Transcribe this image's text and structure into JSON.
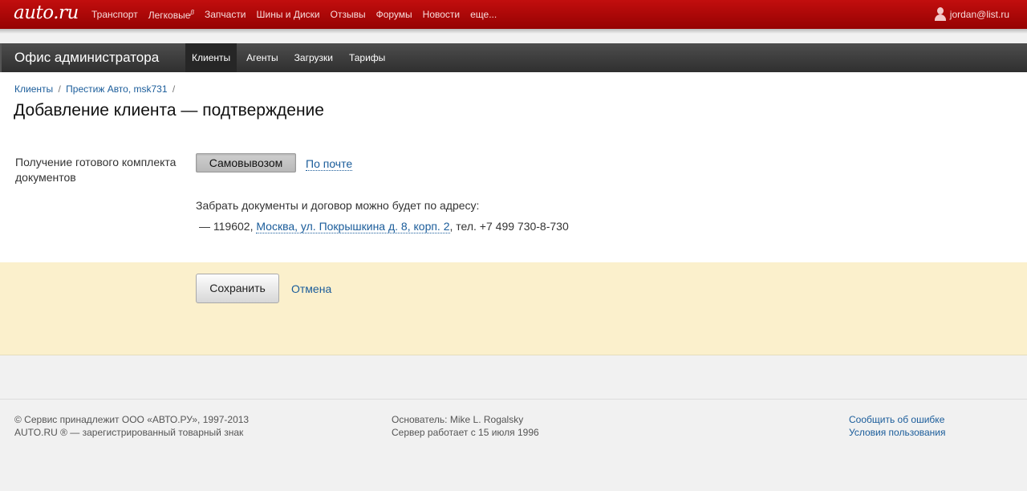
{
  "topbar": {
    "logo": "auto.ru",
    "nav": [
      {
        "label": "Транспорт"
      },
      {
        "label": "Легковые",
        "sup": "β"
      },
      {
        "label": "Запчасти"
      },
      {
        "label": "Шины и Диски"
      },
      {
        "label": "Отзывы"
      },
      {
        "label": "Форумы"
      },
      {
        "label": "Новости"
      },
      {
        "label": "еще..."
      }
    ],
    "user_email": "jordan@list.ru",
    "user_icon": "user-icon"
  },
  "adminbar": {
    "title": "Офис администратора",
    "tabs": [
      {
        "label": "Клиенты",
        "active": true
      },
      {
        "label": "Агенты",
        "active": false
      },
      {
        "label": "Загрузки",
        "active": false
      },
      {
        "label": "Тарифы",
        "active": false
      }
    ]
  },
  "breadcrumb": {
    "items": [
      "Клиенты",
      "Престиж Авто, msk731"
    ],
    "separator": "/"
  },
  "page_title": "Добавление клиента — подтверждение",
  "form": {
    "field_label": "Получение готового комплекта документов",
    "option_selected": "Самовывозом",
    "option_other": "По почте",
    "pickup_text": "Забрать документы и договор можно будет по адресу:",
    "address_prefix": "— 119602,",
    "address_link": "Москва, ул. Покрышкина д. 8, корп. 2",
    "address_suffix": ", тел. +7 499 730-8-730"
  },
  "actions": {
    "save_label": "Сохранить",
    "cancel_label": "Отмена"
  },
  "footer": {
    "col1": [
      "© Сервис принадлежит ООО «АВТО.РУ», 1997-2013",
      "AUTO.RU ® — зарегистрированный товарный знак"
    ],
    "col2": [
      "Основатель: Mike L. Rogalsky",
      "Сервер работает с 15 июля 1996"
    ],
    "col3": [
      "Сообщить об ошибке",
      "Условия пользования"
    ]
  },
  "colors": {
    "topbar": "#b00808",
    "adminbar": "#3a3a3a",
    "actions_bg": "#fbf0cc",
    "link": "#1a5c9a"
  }
}
